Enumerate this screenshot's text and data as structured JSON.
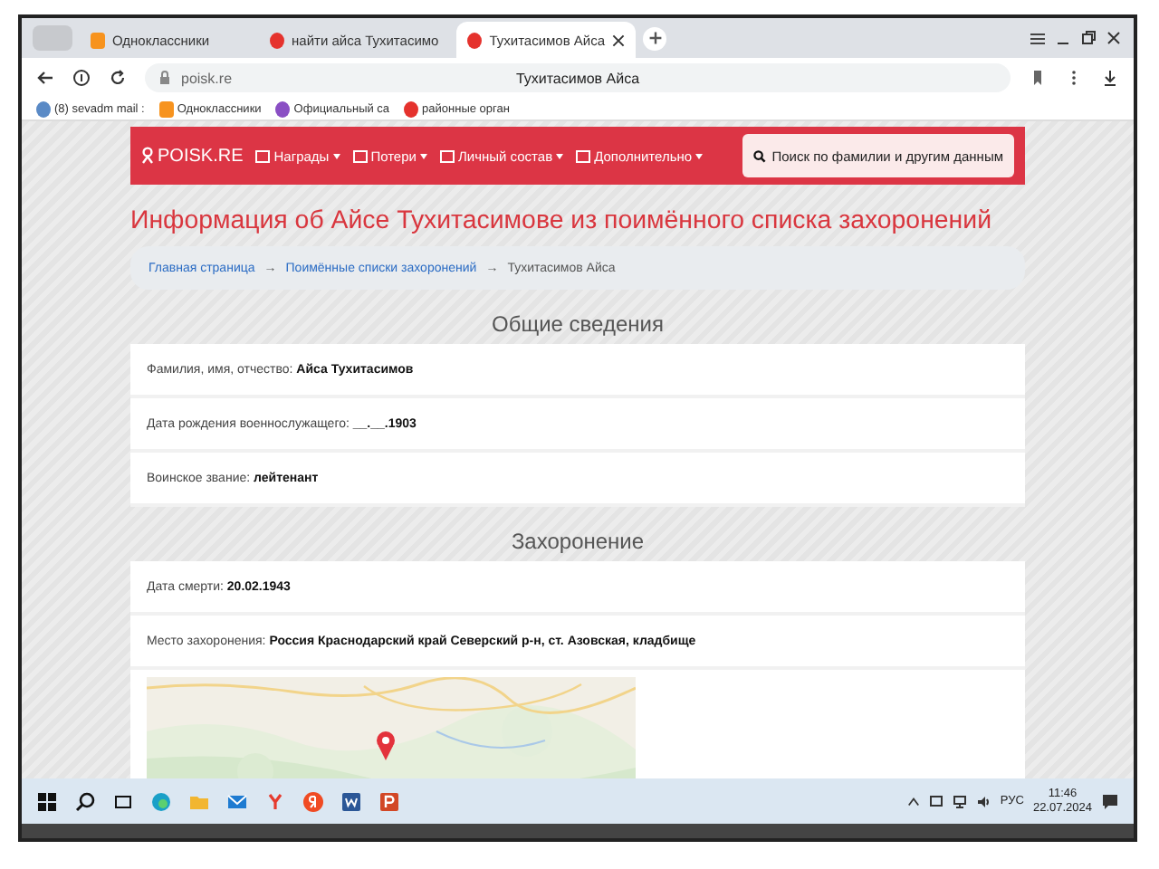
{
  "tabs": [
    {
      "label": "Одноклассники",
      "selected": false
    },
    {
      "label": "найти айса Тухитасимо",
      "selected": false
    },
    {
      "label": "Тухитасимов Айса",
      "selected": true
    }
  ],
  "address": {
    "url": "poisk.re",
    "title": "Тухитасимов Айса"
  },
  "bookmarks": [
    "(8) sevadm mail :",
    "Одноклассники",
    "Официальный са",
    "районные орган"
  ],
  "navbar": {
    "brand": "POISK.RE",
    "items": [
      "Награды",
      "Потери",
      "Личный состав",
      "Дополнительно"
    ],
    "search_button": "Поиск по фамилии и другим данным"
  },
  "heading": "Информация об Айсе Тухитасимове из поимённого списка захоронений",
  "breadcrumb": [
    {
      "label": "Главная страница",
      "kind": "link"
    },
    {
      "label": "→",
      "kind": "separator"
    },
    {
      "label": "Поимённые списки захоронений",
      "kind": "link"
    },
    {
      "label": "→",
      "kind": "separator"
    },
    {
      "label": "Тухитасимов Айса",
      "kind": "current"
    }
  ],
  "sections": [
    {
      "title": "Общие сведения",
      "rows": [
        {
          "label": "Фамилия, имя, отчество:",
          "value": "Айса Тухитасимов"
        },
        {
          "label": "Дата рождения военнослужащего:",
          "value": "__.__.1903"
        },
        {
          "label": "Воинское звание:",
          "value": "лейтенант"
        }
      ]
    },
    {
      "title": "Захоронение",
      "rows": [
        {
          "label": "Дата смерти:",
          "value": "20.02.1943"
        },
        {
          "label": "Место захоронения:",
          "value": "Россия Краснодарский край Северский р-н, ст. Азовская, кладбище"
        }
      ],
      "map": {
        "kind": "picture"
      }
    }
  ],
  "taskbar": {
    "language": "РУС",
    "time": "11:46",
    "date": "22.07.2024"
  }
}
